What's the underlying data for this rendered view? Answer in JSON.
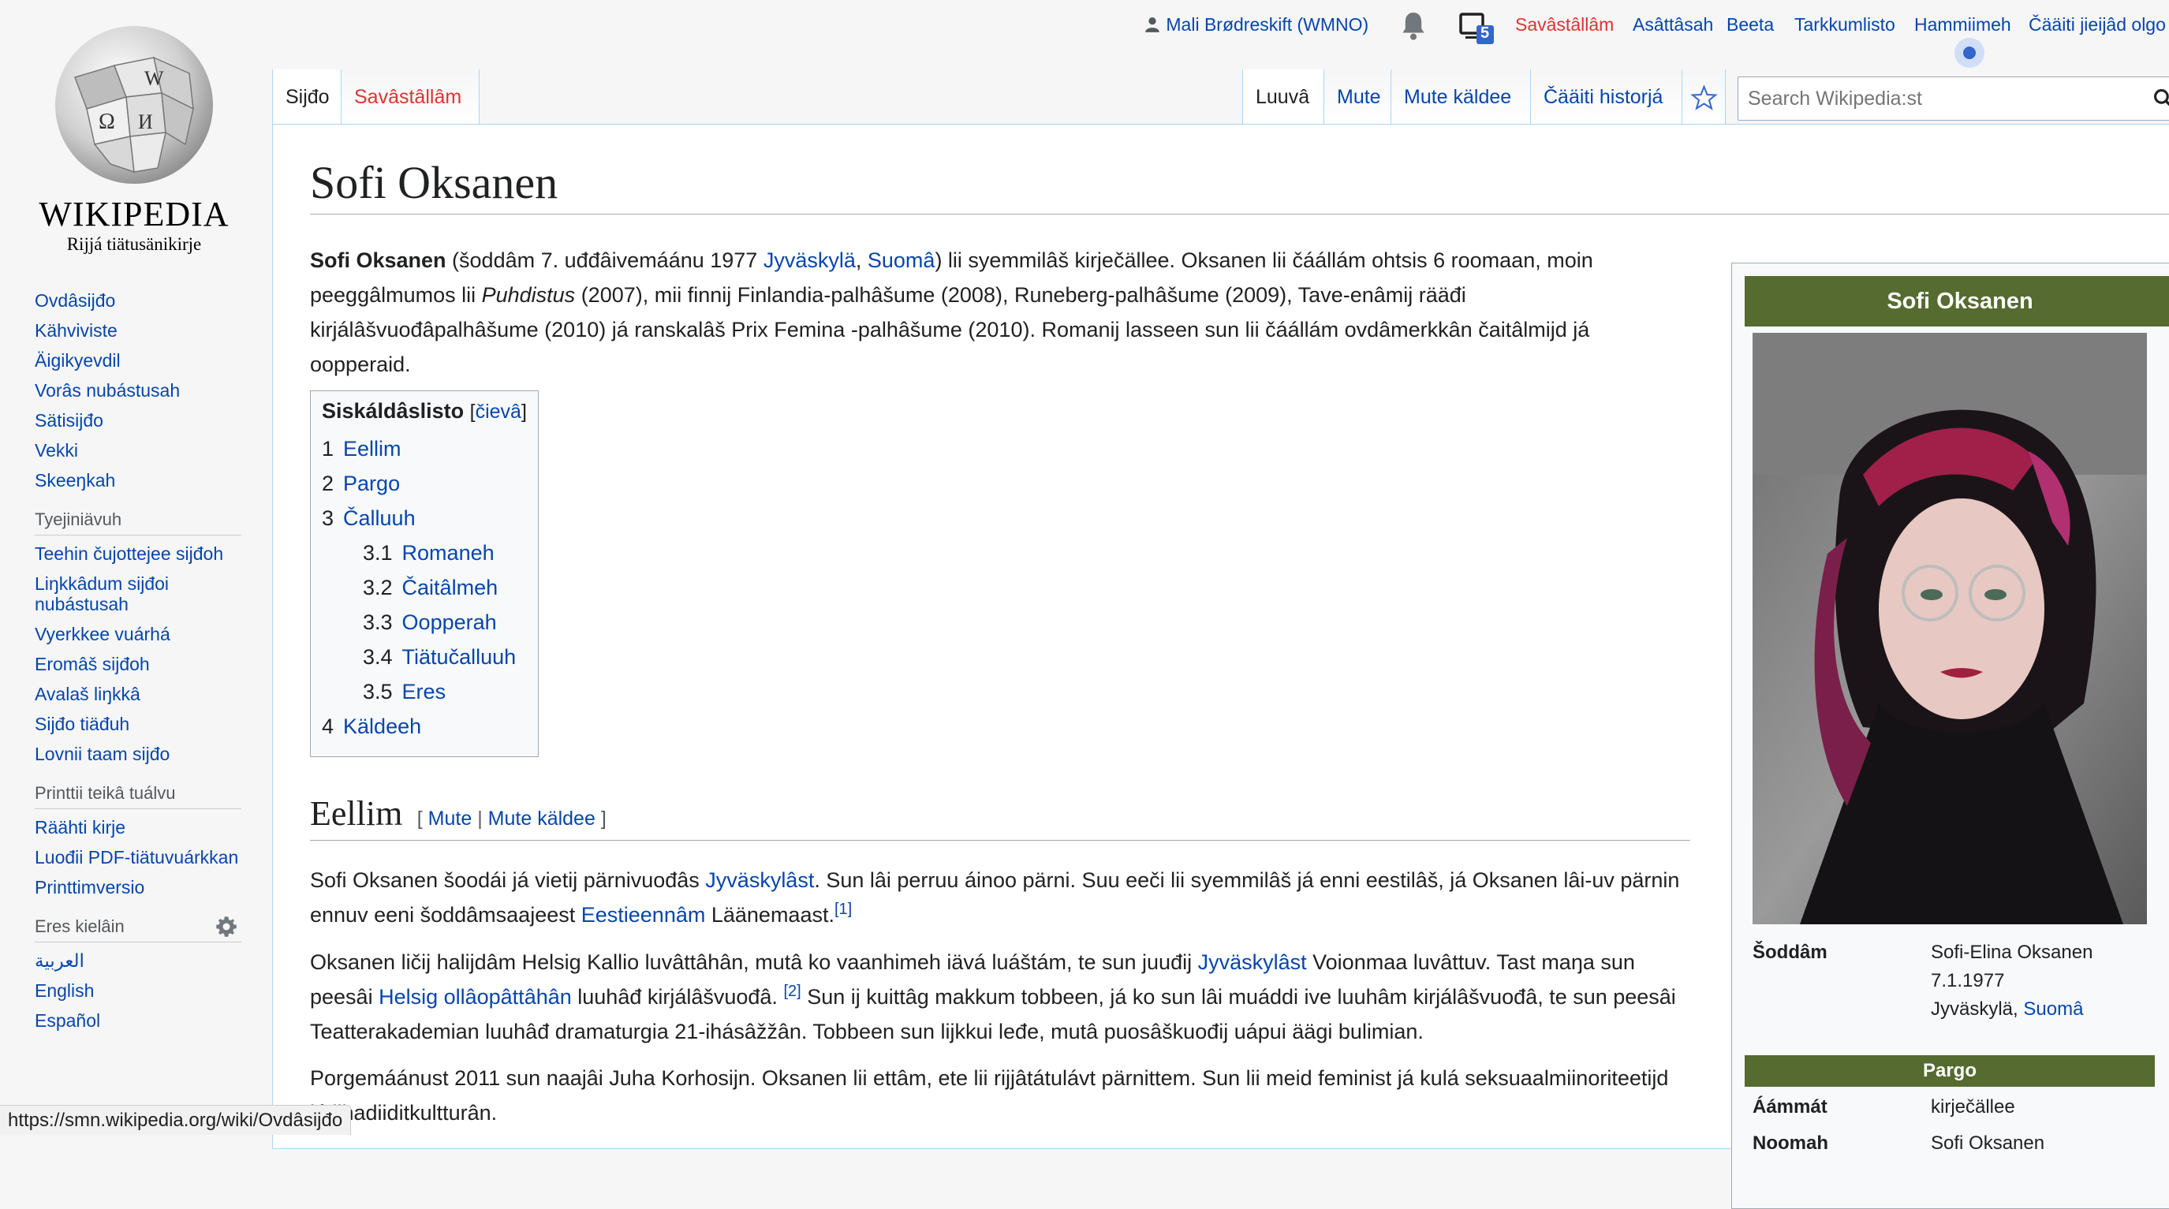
{
  "logo": {
    "wordmark": "WIKIPEDIA",
    "tagline": "Rijjá tiätusänikirje"
  },
  "personal": {
    "user": "Mali Brødreskift (WMNO)",
    "notice_count": "5",
    "links": [
      "Savâstâllâm",
      "Asâttâsah",
      "Beeta",
      "Tarkkumlisto",
      "Hammiimeh",
      "Čääiti jieijâd olgo"
    ]
  },
  "tabs": {
    "left": [
      "Sijđo",
      "Savâstâllâm"
    ],
    "right": [
      "Luuvâ",
      "Mute",
      "Mute käldee",
      "Čääiti historjá"
    ]
  },
  "search": {
    "placeholder": "Search Wikipedia:st"
  },
  "nav": {
    "main": [
      "Ovdâsijđo",
      "Kähviviste",
      "Äigikyevdil",
      "Vorâs nubástusah",
      "Sätisijđo",
      "Vekki",
      "Skeeŋkah"
    ],
    "tools_heading": "Tyejiniävuh",
    "tools": [
      "Teehin čujottejee sijđoh",
      "Liŋkkâdum sijđoi nubástusah",
      "Vyerkkee vuárhá",
      "Eromâš sijđoh",
      "Avalaš liŋkkâ",
      "Sijđo tiäđuh",
      "Lovnii taam sijđo"
    ],
    "print_heading": "Printtii teikâ tuálvu",
    "print": [
      "Räähti kirje",
      "Luođii PDF-tiätuvuárkkan",
      "Printtimversio"
    ],
    "lang_heading": "Eres kielâin",
    "langs": [
      "العربية",
      "English",
      "Español"
    ]
  },
  "article": {
    "title": "Sofi Oksanen",
    "intro": {
      "bold": "Sofi Oksanen",
      "t1": " (šoddâm 7. uđđâivemáánu 1977 ",
      "l1": "Jyväskylä",
      "t2": ", ",
      "l2": "Suomâ",
      "t3": ") lii syemmilâš kirječällee. Oksanen lii čáállám ohtsis 6 roomaan, moin peeggâlmumos lii ",
      "italic": "Puhdistus",
      "t4": " (2007), mii finnij Finlandia-palhâšume (2008), Runeberg-palhâšume (2009), Tave-enâmij rääđi kirjálâšvuođâpalhâšume (2010) já ranskalâš Prix Femina -palhâšume (2010). Romanij lasseen sun lii čáállám ovdâmerkkân čaitâlmijd já oopperaid."
    },
    "toc": {
      "title": "Siskáldâslisto",
      "toggle_open": "[",
      "toggle": "čievâ",
      "toggle_close": "]",
      "items": [
        {
          "num": "1",
          "label": "Eellim"
        },
        {
          "num": "2",
          "label": "Pargo"
        },
        {
          "num": "3",
          "label": "Čalluuh"
        },
        {
          "num": "3.1",
          "label": "Romaneh"
        },
        {
          "num": "3.2",
          "label": "Čaitâlmeh"
        },
        {
          "num": "3.3",
          "label": "Oopperah"
        },
        {
          "num": "3.4",
          "label": "Tiätučalluuh"
        },
        {
          "num": "3.5",
          "label": "Eres"
        },
        {
          "num": "4",
          "label": "Käldeeh"
        }
      ]
    },
    "section1": {
      "heading": "Eellim",
      "edit_open": "[",
      "edit": "Mute",
      "sep": "|",
      "edit_source": "Mute käldee",
      "edit_close": "]",
      "p1": {
        "t1": "Sofi Oksanen šoodái já vietij pärnivuođâs ",
        "l1": "Jyväskylâst",
        "t2": ". Sun lâi perruu áinoo pärni. Suu eeči lii syemmilâš já enni eestilâš, já Oksanen lâi-uv pärnin ennuv eeni šoddâmsaajeest ",
        "l2": "Eestieennâm",
        "t3": " Läänemaast.",
        "ref": "[1]"
      },
      "p2": {
        "t1": "Oksanen ličij halijdâm Helsig Kallio luvâttâhân, mutâ ko vaanhimeh iävá luáštám, te sun juuđij ",
        "l1": "Jyväskylâst",
        "t2": " Voionmaa luvâttuv. Tast maŋa sun peesâi ",
        "l2": "Helsig ollâopâttâhân",
        "t3": " luuhâđ kirjálâšvuođâ. ",
        "ref": "[2]",
        "t4": " Sun ij kuittâg makkum tobbeen, já ko sun lâi muáddi ive luuhâm kirjálâšvuođâ, te sun peesâi Teatterakademian luuhâđ dramaturgia 21-ihásâžžân. Tobbeen sun lijkkui leđe, mutâ puosâškuođij uápui äägi bulimian."
      },
      "p3": "Porgemáánust 2011 sun naajâi Juha Korhosijn. Oksanen lii ettâm, ete lii rijjâtátulávt pärnittem. Sun lii meid feminist já kulá seksuaalmiinoriteetijd já lihadiiditkultturân."
    }
  },
  "infobox": {
    "title": "Sofi Oksanen",
    "born_label": "Šoddâm",
    "born_line1": "Sofi-Elina Oksanen",
    "born_line2": "7.1.1977",
    "born_place": "Jyväskylä, ",
    "born_link": "Suomâ",
    "section_work": "Pargo",
    "job_label": "Áámmát",
    "job_value": "kirječällee",
    "name_label": "Noomah",
    "name_value": "Sofi Oksanen"
  },
  "statusbar": {
    "url": "https://smn.wikipedia.org/wiki/Ovdâsijđo"
  },
  "colors": {
    "link": "#0645ad",
    "infobox_header": "#556b2f",
    "red_link": "#d33"
  }
}
